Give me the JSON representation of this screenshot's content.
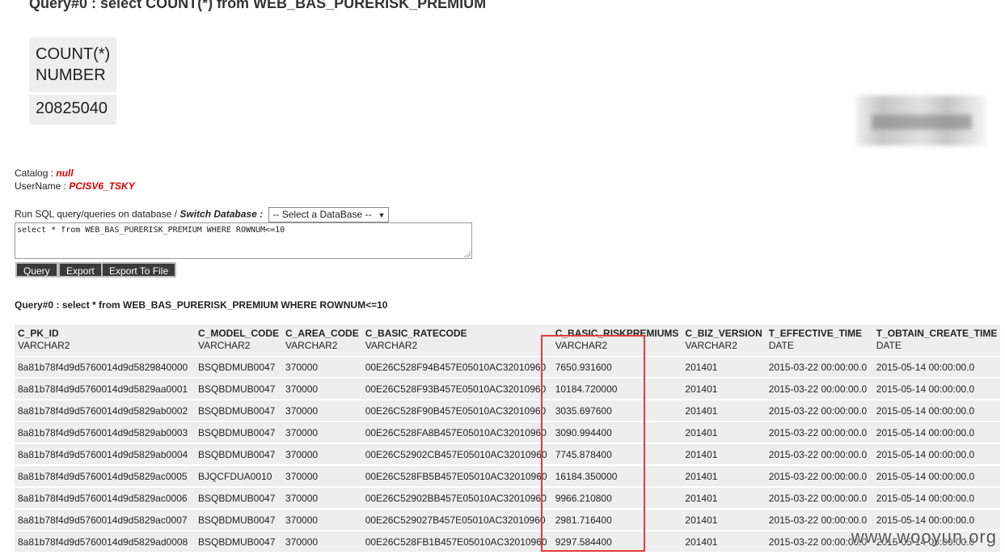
{
  "title": "Query#0 : select COUNT(*) from WEB_BAS_PURERISK_PREMIUM",
  "count_table": {
    "col_name": "COUNT(*)",
    "col_type": "NUMBER",
    "value": "20825040"
  },
  "info": {
    "catalog_label": "Catalog :",
    "catalog_value": "null",
    "username_label": "UserName :",
    "username_value": "PCISV6_TSKY"
  },
  "run": {
    "prefix": "Run SQL query/queries on database /",
    "switch_label": "Switch Database :",
    "select_value": "-- Select a DataBase --",
    "sql_text": "select * from WEB_BAS_PURERISK_PREMIUM WHERE ROWNUM<=10"
  },
  "buttons": {
    "query": "Query",
    "export": "Export",
    "export_file": "Export To File"
  },
  "result_title": "Query#0 : select * from WEB_BAS_PURERISK_PREMIUM WHERE ROWNUM<=10",
  "result": {
    "columns": [
      {
        "name": "C_PK_ID",
        "type": "VARCHAR2"
      },
      {
        "name": "C_MODEL_CODE",
        "type": "VARCHAR2"
      },
      {
        "name": "C_AREA_CODE",
        "type": "VARCHAR2"
      },
      {
        "name": "C_BASIC_RATECODE",
        "type": "VARCHAR2"
      },
      {
        "name": "C_BASIC_RISKPREMIUMS",
        "type": "VARCHAR2"
      },
      {
        "name": "C_BIZ_VERSION",
        "type": "VARCHAR2"
      },
      {
        "name": "T_EFFECTIVE_TIME",
        "type": "DATE"
      },
      {
        "name": "T_OBTAIN_CREATE_TIME",
        "type": "DATE"
      }
    ],
    "rows": [
      [
        "8a81b78f4d9d5760014d9d5829840000",
        "BSQBDMUB0047",
        "370000",
        "00E26C528F94B457E05010AC32010960",
        "7650.931600",
        "201401",
        "2015-03-22 00:00:00.0",
        "2015-05-14 00:00:00.0"
      ],
      [
        "8a81b78f4d9d5760014d9d5829aa0001",
        "BSQBDMUB0047",
        "370000",
        "00E26C528F93B457E05010AC32010960",
        "10184.720000",
        "201401",
        "2015-03-22 00:00:00.0",
        "2015-05-14 00:00:00.0"
      ],
      [
        "8a81b78f4d9d5760014d9d5829ab0002",
        "BSQBDMUB0047",
        "370000",
        "00E26C528F90B457E05010AC32010960",
        "3035.697600",
        "201401",
        "2015-03-22 00:00:00.0",
        "2015-05-14 00:00:00.0"
      ],
      [
        "8a81b78f4d9d5760014d9d5829ab0003",
        "BSQBDMUB0047",
        "370000",
        "00E26C528FA8B457E05010AC32010960",
        "3090.994400",
        "201401",
        "2015-03-22 00:00:00.0",
        "2015-05-14 00:00:00.0"
      ],
      [
        "8a81b78f4d9d5760014d9d5829ab0004",
        "BSQBDMUB0047",
        "370000",
        "00E26C52902CB457E05010AC32010960",
        "7745.878400",
        "201401",
        "2015-03-22 00:00:00.0",
        "2015-05-14 00:00:00.0"
      ],
      [
        "8a81b78f4d9d5760014d9d5829ac0005",
        "BJQCFDUA0010",
        "370000",
        "00E26C528FB5B457E05010AC32010960",
        "16184.350000",
        "201401",
        "2015-03-22 00:00:00.0",
        "2015-05-14 00:00:00.0"
      ],
      [
        "8a81b78f4d9d5760014d9d5829ac0006",
        "BSQBDMUB0047",
        "370000",
        "00E26C52902BB457E05010AC32010960",
        "9966.210800",
        "201401",
        "2015-03-22 00:00:00.0",
        "2015-05-14 00:00:00.0"
      ],
      [
        "8a81b78f4d9d5760014d9d5829ac0007",
        "BSQBDMUB0047",
        "370000",
        "00E26C529027B457E05010AC32010960",
        "2981.716400",
        "201401",
        "2015-03-22 00:00:00.0",
        "2015-05-14 00:00:00.0"
      ],
      [
        "8a81b78f4d9d5760014d9d5829ad0008",
        "BSQBDMUB0047",
        "370000",
        "00E26C528FB1B457E05010AC32010960",
        "9297.584400",
        "201401",
        "2015-03-22 00:00:00.0",
        "2015-05-14 00:00:00.0"
      ]
    ]
  },
  "watermark": "www.wooyun.org",
  "colors": {
    "highlight": "#e53a3a",
    "accent_red": "#e00000",
    "button_bg": "#3a3a3a"
  }
}
